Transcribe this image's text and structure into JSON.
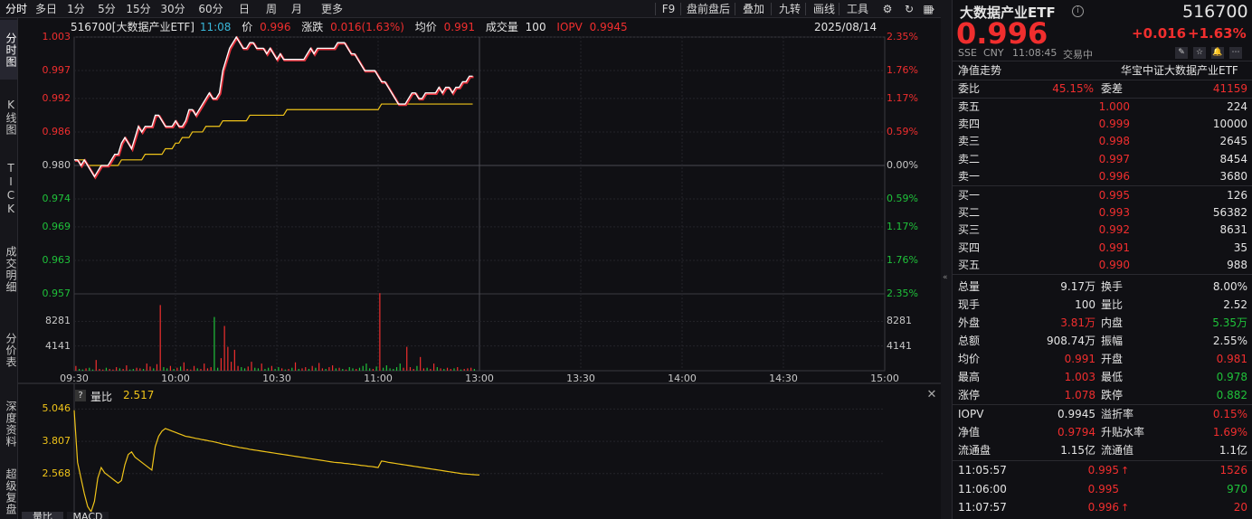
{
  "toolbar": {
    "periods": [
      "分时",
      "多日",
      "1分",
      "5分",
      "15分",
      "30分",
      "60分",
      "日",
      "周",
      "月",
      "更多"
    ],
    "right_items": [
      "F9",
      "盘前盘后",
      "叠加",
      "九转",
      "画线",
      "工具"
    ]
  },
  "left_tabs": [
    "分时图",
    "K线图",
    "TICK",
    "成交明细",
    "分价表",
    "深度资料",
    "超级复盘"
  ],
  "info_bar": {
    "code_name": "516700[大数据产业ETF]",
    "time": "11:08",
    "price_label": "价",
    "price": "0.996",
    "change_label": "涨跌",
    "change": "0.016(1.63%)",
    "avg_label": "均价",
    "avg": "0.991",
    "volume_label": "成交量",
    "volume": "100",
    "iopv_label": "IOPV",
    "iopv": "0.9945",
    "date": "2025/08/14"
  },
  "chart_data": {
    "type": "line",
    "prev_close": 0.98,
    "y_ticks_left": [
      "1.003",
      "0.997",
      "0.992",
      "0.986",
      "0.980",
      "0.974",
      "0.969",
      "0.963",
      "0.957"
    ],
    "y_ticks_right": [
      "2.35%",
      "1.76%",
      "1.17%",
      "0.59%",
      "0.00%",
      "0.59%",
      "1.17%",
      "1.76%",
      "2.35%"
    ],
    "vol_ticks": [
      "8281",
      "4141"
    ],
    "x_ticks": [
      "09:30",
      "10:00",
      "10:30",
      "11:00",
      "13:00",
      "13:30",
      "14:00",
      "14:30",
      "15:00"
    ],
    "ylim": [
      0.957,
      1.003
    ],
    "vol_max": 12422,
    "x_minutes_total": 240,
    "price": [
      0.981,
      0.981,
      0.98,
      0.981,
      0.98,
      0.979,
      0.978,
      0.979,
      0.98,
      0.98,
      0.98,
      0.981,
      0.982,
      0.982,
      0.984,
      0.985,
      0.984,
      0.983,
      0.985,
      0.987,
      0.986,
      0.987,
      0.987,
      0.987,
      0.989,
      0.989,
      0.988,
      0.987,
      0.987,
      0.987,
      0.988,
      0.987,
      0.987,
      0.988,
      0.99,
      0.99,
      0.989,
      0.99,
      0.991,
      0.992,
      0.993,
      0.992,
      0.992,
      0.993,
      0.997,
      0.999,
      1.001,
      1.002,
      1.003,
      1.002,
      1.001,
      1.001,
      1.002,
      1.002,
      1.001,
      1.001,
      1.001,
      1.0,
      1.001,
      1.0,
      0.999,
      1.0,
      0.999,
      0.999,
      0.999,
      0.999,
      0.999,
      0.999,
      0.999,
      1.0,
      1.001,
      1.0,
      1.001,
      1.001,
      1.001,
      1.001,
      1.001,
      1.001,
      1.002,
      1.002,
      1.002,
      1.001,
      1.0,
      1.0,
      0.999,
      0.998,
      0.997,
      0.997,
      0.997,
      0.997,
      0.996,
      0.995,
      0.995,
      0.994,
      0.993,
      0.992,
      0.991,
      0.991,
      0.991,
      0.992,
      0.993,
      0.993,
      0.992,
      0.992,
      0.993,
      0.993,
      0.993,
      0.993,
      0.994,
      0.993,
      0.994,
      0.994,
      0.993,
      0.994,
      0.994,
      0.995,
      0.995,
      0.996,
      0.996
    ],
    "avg": [
      0.981,
      0.981,
      0.981,
      0.981,
      0.98,
      0.98,
      0.98,
      0.98,
      0.98,
      0.98,
      0.98,
      0.98,
      0.98,
      0.98,
      0.981,
      0.981,
      0.981,
      0.981,
      0.981,
      0.981,
      0.981,
      0.982,
      0.982,
      0.982,
      0.982,
      0.982,
      0.982,
      0.983,
      0.983,
      0.983,
      0.984,
      0.984,
      0.985,
      0.985,
      0.985,
      0.986,
      0.986,
      0.986,
      0.986,
      0.987,
      0.987,
      0.987,
      0.987,
      0.987,
      0.988,
      0.988,
      0.988,
      0.988,
      0.988,
      0.988,
      0.988,
      0.988,
      0.989,
      0.989,
      0.989,
      0.989,
      0.989,
      0.989,
      0.989,
      0.989,
      0.989,
      0.989,
      0.989,
      0.99,
      0.99,
      0.99,
      0.99,
      0.99,
      0.99,
      0.99,
      0.99,
      0.99,
      0.99,
      0.99,
      0.99,
      0.99,
      0.99,
      0.99,
      0.99,
      0.99,
      0.99,
      0.99,
      0.99,
      0.99,
      0.99,
      0.99,
      0.99,
      0.99,
      0.99,
      0.99,
      0.99,
      0.991,
      0.991,
      0.991,
      0.991,
      0.991,
      0.991,
      0.991,
      0.991,
      0.991,
      0.991,
      0.991,
      0.991,
      0.991,
      0.991,
      0.991,
      0.991,
      0.991,
      0.991,
      0.991,
      0.991,
      0.991,
      0.991,
      0.991,
      0.991,
      0.991,
      0.991,
      0.991,
      0.991
    ],
    "volumes": [
      800,
      300,
      200,
      400,
      500,
      200,
      1800,
      300,
      200,
      500,
      300,
      200,
      600,
      400,
      300,
      900,
      200,
      300,
      500,
      400,
      300,
      1200,
      700,
      400,
      1100,
      11000,
      600,
      400,
      800,
      300,
      500,
      700,
      1400,
      300,
      200,
      800,
      400,
      300,
      1200,
      400,
      600,
      9000,
      500,
      2100,
      7500,
      4000,
      1500,
      3500,
      800,
      600,
      400,
      700,
      1500,
      500,
      400,
      1200,
      300,
      500,
      800,
      300,
      600,
      400,
      200,
      300,
      500,
      1400,
      300,
      400,
      600,
      300,
      800,
      500,
      1300,
      400,
      300,
      600,
      900,
      400,
      500,
      300,
      200,
      600,
      400,
      300,
      500,
      800,
      1200,
      400,
      300,
      700,
      13000,
      500,
      900,
      400,
      300,
      600,
      1200,
      500,
      4000,
      600,
      300,
      800,
      2300,
      400,
      500,
      300,
      1200,
      600,
      400,
      300,
      500,
      300,
      400,
      600,
      200,
      300,
      400,
      500,
      300
    ],
    "vol_colors_up": [
      1,
      0,
      0,
      1,
      0,
      0,
      1,
      1,
      1,
      0,
      1,
      1,
      1,
      0,
      1,
      1,
      0,
      0,
      1,
      1,
      0,
      1,
      1,
      0,
      1,
      1,
      0,
      0,
      1,
      0,
      1,
      0,
      1,
      1,
      1,
      1,
      0,
      1,
      1,
      1,
      1,
      0,
      0,
      1,
      1,
      1,
      1,
      1,
      1,
      0,
      0,
      1,
      1,
      0,
      0,
      1,
      0,
      0,
      1,
      0,
      0,
      1,
      0,
      1,
      0,
      1,
      0,
      1,
      1,
      0,
      1,
      0,
      1,
      1,
      0,
      1,
      1,
      0,
      1,
      0,
      1,
      0,
      0,
      1,
      0,
      0,
      0,
      0,
      1,
      0,
      1,
      0,
      0,
      0,
      0,
      0,
      0,
      1,
      1,
      1,
      1,
      0,
      1,
      1,
      0,
      1,
      1,
      0,
      1,
      0,
      1,
      1,
      0,
      1,
      0,
      1,
      1,
      1,
      0
    ],
    "ratio_panel": {
      "label": "量比",
      "value": "2.517",
      "y_ticks": [
        "5.046",
        "3.807",
        "2.568"
      ],
      "ylim": [
        1.1,
        5.2
      ],
      "values": [
        5.0,
        3.0,
        2.4,
        1.8,
        1.3,
        1.1,
        1.5,
        2.4,
        2.8,
        2.6,
        2.5,
        2.4,
        2.3,
        2.2,
        2.3,
        2.9,
        3.3,
        3.4,
        3.2,
        3.1,
        3.0,
        2.9,
        2.8,
        2.7,
        3.6,
        4.0,
        4.2,
        4.3,
        4.25,
        4.2,
        4.15,
        4.1,
        4.05,
        4.0,
        3.98,
        3.95,
        3.92,
        3.9,
        3.87,
        3.85,
        3.82,
        3.8,
        3.77,
        3.74,
        3.7,
        3.68,
        3.65,
        3.62,
        3.6,
        3.57,
        3.55,
        3.53,
        3.5,
        3.48,
        3.46,
        3.44,
        3.42,
        3.4,
        3.38,
        3.36,
        3.34,
        3.32,
        3.3,
        3.28,
        3.26,
        3.24,
        3.22,
        3.2,
        3.18,
        3.16,
        3.14,
        3.12,
        3.1,
        3.08,
        3.06,
        3.04,
        3.02,
        3.0,
        2.99,
        2.98,
        2.96,
        2.95,
        2.93,
        2.92,
        2.9,
        2.88,
        2.87,
        2.85,
        2.84,
        2.82,
        2.8,
        3.05,
        3.03,
        3.0,
        2.98,
        2.96,
        2.94,
        2.92,
        2.9,
        2.88,
        2.86,
        2.84,
        2.82,
        2.8,
        2.78,
        2.76,
        2.74,
        2.72,
        2.7,
        2.68,
        2.66,
        2.64,
        2.62,
        2.6,
        2.58,
        2.56,
        2.55,
        2.54,
        2.53,
        2.52,
        2.517
      ]
    }
  },
  "bottom_tabs": [
    "量比",
    "MACD"
  ],
  "quote": {
    "name": "大数据产业ETF",
    "code": "516700",
    "price": "0.996",
    "change": "+0.016",
    "change_pct": "+1.63%",
    "exchange": "SSE",
    "currency": "CNY",
    "time": "11:08:45",
    "status": "交易中",
    "nav_trend": "净值走势",
    "index_name": "华宝中证大数据产业ETF",
    "weibi_label": "委比",
    "weibi": "45.15%",
    "weicha_label": "委差",
    "weicha": "41159",
    "sells": [
      {
        "label": "卖五",
        "price": "1.000",
        "vol": "224"
      },
      {
        "label": "卖四",
        "price": "0.999",
        "vol": "10000"
      },
      {
        "label": "卖三",
        "price": "0.998",
        "vol": "2645"
      },
      {
        "label": "卖二",
        "price": "0.997",
        "vol": "8454"
      },
      {
        "label": "卖一",
        "price": "0.996",
        "vol": "3680"
      }
    ],
    "buys": [
      {
        "label": "买一",
        "price": "0.995",
        "vol": "126"
      },
      {
        "label": "买二",
        "price": "0.993",
        "vol": "56382"
      },
      {
        "label": "买三",
        "price": "0.992",
        "vol": "8631"
      },
      {
        "label": "买四",
        "price": "0.991",
        "vol": "35"
      },
      {
        "label": "买五",
        "price": "0.990",
        "vol": "988"
      }
    ],
    "stats": [
      {
        "l1": "总量",
        "v1": "9.17万",
        "c1": "white",
        "l2": "换手",
        "v2": "8.00%",
        "c2": "white"
      },
      {
        "l1": "现手",
        "v1": "100",
        "c1": "white",
        "l2": "量比",
        "v2": "2.52",
        "c2": "white"
      },
      {
        "l1": "外盘",
        "v1": "3.81万",
        "c1": "red",
        "l2": "内盘",
        "v2": "5.35万",
        "c2": "green"
      },
      {
        "l1": "总额",
        "v1": "908.74万",
        "c1": "white",
        "l2": "振幅",
        "v2": "2.55%",
        "c2": "white"
      },
      {
        "l1": "均价",
        "v1": "0.991",
        "c1": "red",
        "l2": "开盘",
        "v2": "0.981",
        "c2": "red"
      },
      {
        "l1": "最高",
        "v1": "1.003",
        "c1": "red",
        "l2": "最低",
        "v2": "0.978",
        "c2": "green"
      },
      {
        "l1": "涨停",
        "v1": "1.078",
        "c1": "red",
        "l2": "跌停",
        "v2": "0.882",
        "c2": "green"
      }
    ],
    "stats2": [
      {
        "l1": "IOPV",
        "v1": "0.9945",
        "c1": "white",
        "l2": "溢折率",
        "v2": "0.15%",
        "c2": "red"
      },
      {
        "l1": "净值",
        "v1": "0.9794",
        "c1": "red",
        "l2": "升贴水率",
        "v2": "1.69%",
        "c2": "red"
      },
      {
        "l1": "流通盘",
        "v1": "1.15亿",
        "c1": "white",
        "l2": "流通值",
        "v2": "1.1亿",
        "c2": "white"
      }
    ],
    "ticks": [
      {
        "time": "11:05:57",
        "price": "0.995",
        "arrow": "↑",
        "vol": "1526",
        "vc": "red"
      },
      {
        "time": "11:06:00",
        "price": "0.995",
        "arrow": "",
        "vol": "970",
        "vc": "green"
      },
      {
        "time": "11:07:57",
        "price": "0.996",
        "arrow": "↑",
        "vol": "20",
        "vc": "red"
      }
    ]
  }
}
